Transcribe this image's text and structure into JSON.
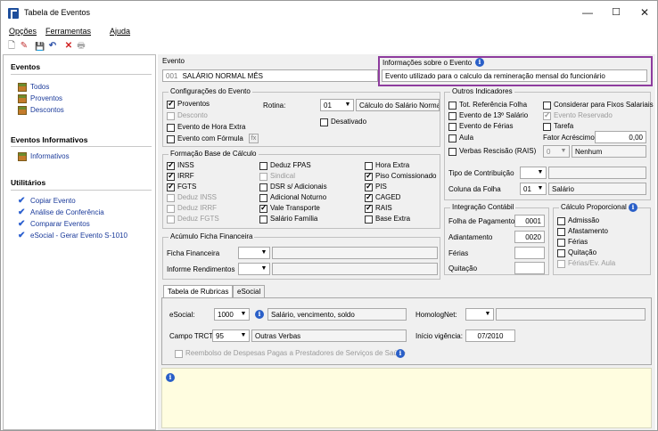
{
  "window": {
    "title": "Tabela de Eventos",
    "minimize": "—",
    "maximize": "☐",
    "close": "✕"
  },
  "menu": {
    "opcoes": "Opções",
    "ferramentas": "Ferramentas",
    "ajuda": "Ajuda"
  },
  "toolbar": {
    "new": "🗋",
    "edit": "✎",
    "save": "💾",
    "undo": "↶",
    "delete": "✕",
    "print": "🖶"
  },
  "sidebar": {
    "eventos_header": "Eventos",
    "eventos": [
      "Todos",
      "Proventos",
      "Descontos"
    ],
    "informativos_header": "Eventos Informativos",
    "informativos": [
      "Informativos"
    ],
    "utilitarios_header": "Utilitários",
    "utilitarios": [
      "Copiar Evento",
      "Análise de Conferência",
      "Comparar Eventos",
      "eSocial - Gerar Evento S-1010"
    ]
  },
  "evento": {
    "label": "Evento",
    "code": "001",
    "name": "SALÁRIO NORMAL MÊS"
  },
  "info_evento": {
    "label": "Informações sobre o Evento",
    "value": "Evento utilizado para o calculo da remineração mensal do funcionário"
  },
  "config": {
    "title": "Configurações do Evento",
    "proventos": "Proventos",
    "desconto": "Desconto",
    "hora_extra": "Evento de Hora Extra",
    "com_formula": "Evento com Fórmula",
    "rotina_label": "Rotina:",
    "rotina_value": "01",
    "rotina_desc": "Cálculo do Salário Norma",
    "desativado": "Desativado",
    "formula_btn": "fx"
  },
  "formacao": {
    "title": "Formação Base de Cálculo",
    "col1": [
      "INSS",
      "IRRF",
      "FGTS",
      "Deduz INSS",
      "Deduz IRRF",
      "Deduz FGTS"
    ],
    "col2": [
      "Deduz FPAS",
      "Sindical",
      "DSR s/ Adicionais",
      "Adicional Noturno",
      "Vale Transporte",
      "Salário Família"
    ],
    "col3": [
      "Hora Extra",
      "Piso Comissionado",
      "PIS",
      "CAGED",
      "RAIS",
      "Base Extra"
    ]
  },
  "acumulo": {
    "title": "Acúmulo Ficha Financeira",
    "ficha": "Ficha Financeira",
    "informe": "Informe Rendimentos"
  },
  "outros": {
    "title": "Outros Indicadores",
    "tot_ref": "Tot. Referência Folha",
    "considerar": "Considerar para Fixos Salariais",
    "decimo": "Evento de 13º Salário",
    "reservado": "Evento Reservado",
    "ferias": "Evento de Férias",
    "tarefa": "Tarefa",
    "aula": "Aula",
    "fator_label": "Fator Acréscimo",
    "fator_value": "0,00",
    "verbas": "Verbas Rescisão (RAIS)",
    "verbas_value": "0",
    "verbas_desc": "Nenhum",
    "tipo_contrib": "Tipo de Contribuição",
    "coluna_folha": "Coluna da Folha",
    "coluna_value": "01",
    "coluna_desc": "Salário"
  },
  "integracao": {
    "title": "Integração Contábil",
    "folha": "Folha de Pagamento",
    "folha_value": "0001",
    "adiantamento": "Adiantamento",
    "adiantamento_value": "0020",
    "ferias": "Férias",
    "quitacao": "Quitação"
  },
  "proporcional": {
    "title": "Cálculo Proporcional",
    "items": [
      "Admissão",
      "Afastamento",
      "Férias",
      "Quitação",
      "Férias/Ev. Aula"
    ]
  },
  "tabs": {
    "rubricas": "Tabela de Rubricas",
    "esocial": "eSocial"
  },
  "rubricas": {
    "esocial_label": "eSocial:",
    "esocial_value": "1000",
    "esocial_desc": "Salário, vencimento, soldo",
    "homolog_label": "HomologNet:",
    "trct_label": "Campo TRCT:",
    "trct_value": "95",
    "trct_desc": "Outras Verbas",
    "inicio_label": "Início vigência:",
    "inicio_value": "07/2010",
    "reembolso": "Reembolso de Despesas Pagas a Prestadores de Serviços de Saúde"
  },
  "colors": {
    "accent": "#1a3a9a",
    "highlight": "#8e3c9e",
    "notes_bg": "#fffde0"
  }
}
